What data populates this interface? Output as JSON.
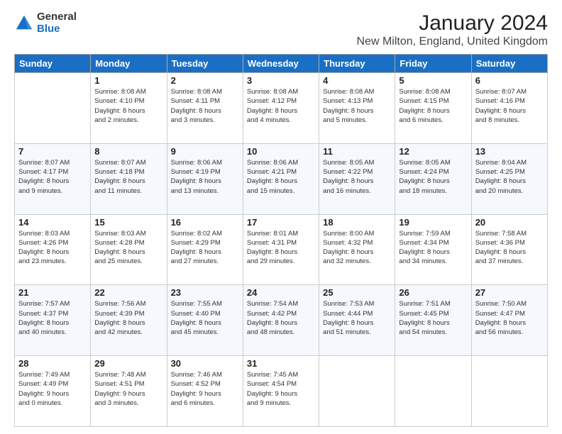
{
  "logo": {
    "general": "General",
    "blue": "Blue"
  },
  "title": "January 2024",
  "subtitle": "New Milton, England, United Kingdom",
  "days_of_week": [
    "Sunday",
    "Monday",
    "Tuesday",
    "Wednesday",
    "Thursday",
    "Friday",
    "Saturday"
  ],
  "weeks": [
    [
      {
        "day": "",
        "info": ""
      },
      {
        "day": "1",
        "info": "Sunrise: 8:08 AM\nSunset: 4:10 PM\nDaylight: 8 hours\nand 2 minutes."
      },
      {
        "day": "2",
        "info": "Sunrise: 8:08 AM\nSunset: 4:11 PM\nDaylight: 8 hours\nand 3 minutes."
      },
      {
        "day": "3",
        "info": "Sunrise: 8:08 AM\nSunset: 4:12 PM\nDaylight: 8 hours\nand 4 minutes."
      },
      {
        "day": "4",
        "info": "Sunrise: 8:08 AM\nSunset: 4:13 PM\nDaylight: 8 hours\nand 5 minutes."
      },
      {
        "day": "5",
        "info": "Sunrise: 8:08 AM\nSunset: 4:15 PM\nDaylight: 8 hours\nand 6 minutes."
      },
      {
        "day": "6",
        "info": "Sunrise: 8:07 AM\nSunset: 4:16 PM\nDaylight: 8 hours\nand 8 minutes."
      }
    ],
    [
      {
        "day": "7",
        "info": "Sunrise: 8:07 AM\nSunset: 4:17 PM\nDaylight: 8 hours\nand 9 minutes."
      },
      {
        "day": "8",
        "info": "Sunrise: 8:07 AM\nSunset: 4:18 PM\nDaylight: 8 hours\nand 11 minutes."
      },
      {
        "day": "9",
        "info": "Sunrise: 8:06 AM\nSunset: 4:19 PM\nDaylight: 8 hours\nand 13 minutes."
      },
      {
        "day": "10",
        "info": "Sunrise: 8:06 AM\nSunset: 4:21 PM\nDaylight: 8 hours\nand 15 minutes."
      },
      {
        "day": "11",
        "info": "Sunrise: 8:05 AM\nSunset: 4:22 PM\nDaylight: 8 hours\nand 16 minutes."
      },
      {
        "day": "12",
        "info": "Sunrise: 8:05 AM\nSunset: 4:24 PM\nDaylight: 8 hours\nand 18 minutes."
      },
      {
        "day": "13",
        "info": "Sunrise: 8:04 AM\nSunset: 4:25 PM\nDaylight: 8 hours\nand 20 minutes."
      }
    ],
    [
      {
        "day": "14",
        "info": "Sunrise: 8:03 AM\nSunset: 4:26 PM\nDaylight: 8 hours\nand 23 minutes."
      },
      {
        "day": "15",
        "info": "Sunrise: 8:03 AM\nSunset: 4:28 PM\nDaylight: 8 hours\nand 25 minutes."
      },
      {
        "day": "16",
        "info": "Sunrise: 8:02 AM\nSunset: 4:29 PM\nDaylight: 8 hours\nand 27 minutes."
      },
      {
        "day": "17",
        "info": "Sunrise: 8:01 AM\nSunset: 4:31 PM\nDaylight: 8 hours\nand 29 minutes."
      },
      {
        "day": "18",
        "info": "Sunrise: 8:00 AM\nSunset: 4:32 PM\nDaylight: 8 hours\nand 32 minutes."
      },
      {
        "day": "19",
        "info": "Sunrise: 7:59 AM\nSunset: 4:34 PM\nDaylight: 8 hours\nand 34 minutes."
      },
      {
        "day": "20",
        "info": "Sunrise: 7:58 AM\nSunset: 4:36 PM\nDaylight: 8 hours\nand 37 minutes."
      }
    ],
    [
      {
        "day": "21",
        "info": "Sunrise: 7:57 AM\nSunset: 4:37 PM\nDaylight: 8 hours\nand 40 minutes."
      },
      {
        "day": "22",
        "info": "Sunrise: 7:56 AM\nSunset: 4:39 PM\nDaylight: 8 hours\nand 42 minutes."
      },
      {
        "day": "23",
        "info": "Sunrise: 7:55 AM\nSunset: 4:40 PM\nDaylight: 8 hours\nand 45 minutes."
      },
      {
        "day": "24",
        "info": "Sunrise: 7:54 AM\nSunset: 4:42 PM\nDaylight: 8 hours\nand 48 minutes."
      },
      {
        "day": "25",
        "info": "Sunrise: 7:53 AM\nSunset: 4:44 PM\nDaylight: 8 hours\nand 51 minutes."
      },
      {
        "day": "26",
        "info": "Sunrise: 7:51 AM\nSunset: 4:45 PM\nDaylight: 8 hours\nand 54 minutes."
      },
      {
        "day": "27",
        "info": "Sunrise: 7:50 AM\nSunset: 4:47 PM\nDaylight: 8 hours\nand 56 minutes."
      }
    ],
    [
      {
        "day": "28",
        "info": "Sunrise: 7:49 AM\nSunset: 4:49 PM\nDaylight: 9 hours\nand 0 minutes."
      },
      {
        "day": "29",
        "info": "Sunrise: 7:48 AM\nSunset: 4:51 PM\nDaylight: 9 hours\nand 3 minutes."
      },
      {
        "day": "30",
        "info": "Sunrise: 7:46 AM\nSunset: 4:52 PM\nDaylight: 9 hours\nand 6 minutes."
      },
      {
        "day": "31",
        "info": "Sunrise: 7:45 AM\nSunset: 4:54 PM\nDaylight: 9 hours\nand 9 minutes."
      },
      {
        "day": "",
        "info": ""
      },
      {
        "day": "",
        "info": ""
      },
      {
        "day": "",
        "info": ""
      }
    ]
  ]
}
